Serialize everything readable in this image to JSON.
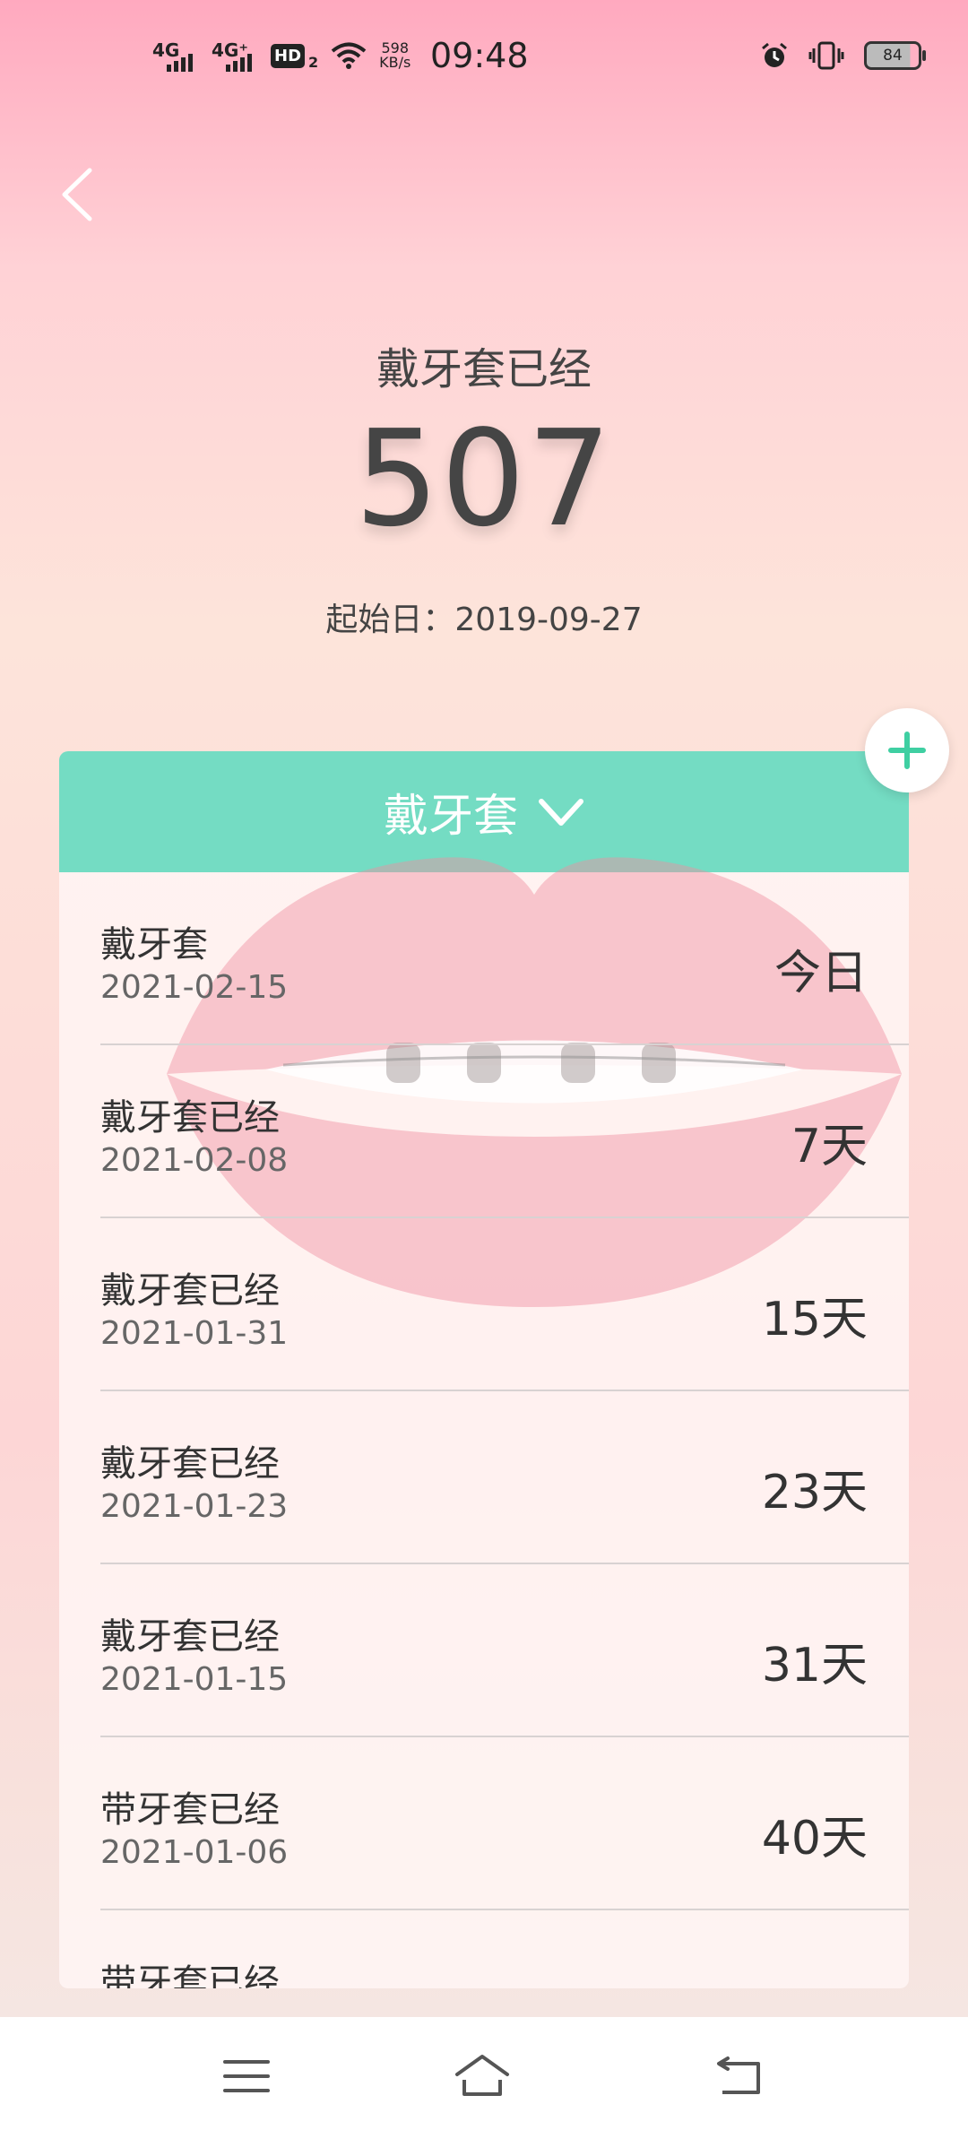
{
  "status_bar": {
    "network1": "4G",
    "network2": "4G⁺",
    "hd_label": "HD",
    "hd_sub": "2",
    "speed_value": "598",
    "speed_unit": "KB/s",
    "time": "09:48",
    "battery": "84"
  },
  "header": {
    "label": "戴牙套已经",
    "count": "507",
    "start_date": "起始日：2019-09-27"
  },
  "category": {
    "selected": "戴牙套"
  },
  "records": [
    {
      "title": "戴牙套",
      "date": "2021-02-15",
      "days": "今日"
    },
    {
      "title": "戴牙套已经",
      "date": "2021-02-08",
      "days": "7天"
    },
    {
      "title": "戴牙套已经",
      "date": "2021-01-31",
      "days": "15天"
    },
    {
      "title": "戴牙套已经",
      "date": "2021-01-23",
      "days": "23天"
    },
    {
      "title": "戴牙套已经",
      "date": "2021-01-15",
      "days": "31天"
    },
    {
      "title": "带牙套已经",
      "date": "2021-01-06",
      "days": "40天"
    },
    {
      "title": "带牙套已经",
      "date": "",
      "days": ""
    }
  ],
  "colors": {
    "accent": "#74dcc3",
    "add_icon": "#3fcfa2"
  },
  "icons": {
    "back": "chevron-left-icon",
    "add": "plus-icon",
    "dropdown": "chevron-down-icon",
    "alarm": "alarm-icon",
    "vibrate": "vibrate-icon",
    "wifi": "wifi-icon",
    "menu": "menu-icon",
    "home": "home-icon",
    "back_nav": "return-icon"
  }
}
